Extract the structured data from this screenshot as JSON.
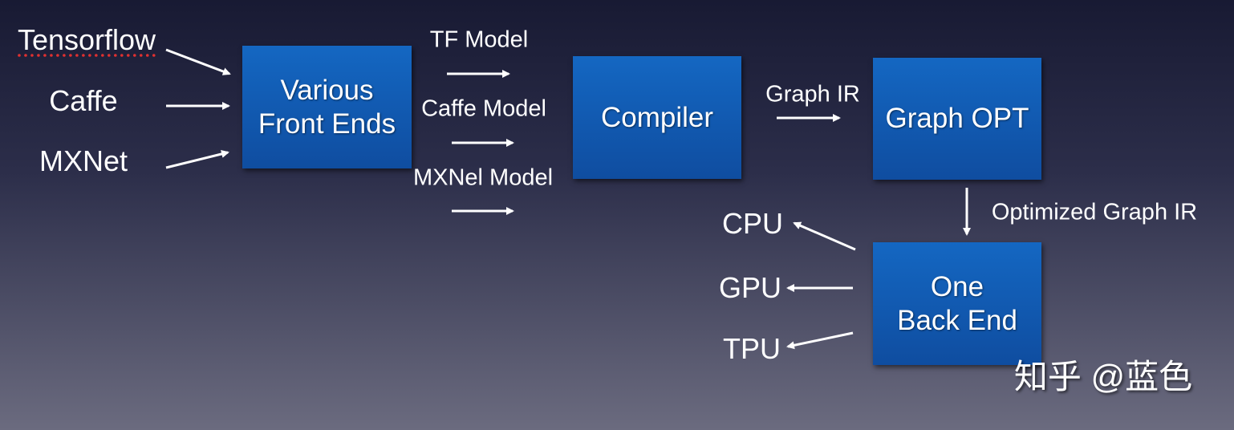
{
  "inputs": [
    "Tensorflow",
    "Caffe",
    "MXNet"
  ],
  "models": [
    "TF Model",
    "Caffe Model",
    "MXNel Model"
  ],
  "boxes": {
    "front_ends": [
      "Various",
      "Front Ends"
    ],
    "compiler": "Compiler",
    "graph_opt": "Graph OPT",
    "back_end": [
      "One",
      "Back End"
    ]
  },
  "edges": {
    "graph_ir": "Graph IR",
    "optimized_graph_ir": "Optimized Graph IR"
  },
  "targets": [
    "CPU",
    "GPU",
    "TPU"
  ],
  "watermark": "知乎 @蓝色",
  "colors": {
    "box": "#1467c2",
    "arrow": "#ffffff"
  }
}
